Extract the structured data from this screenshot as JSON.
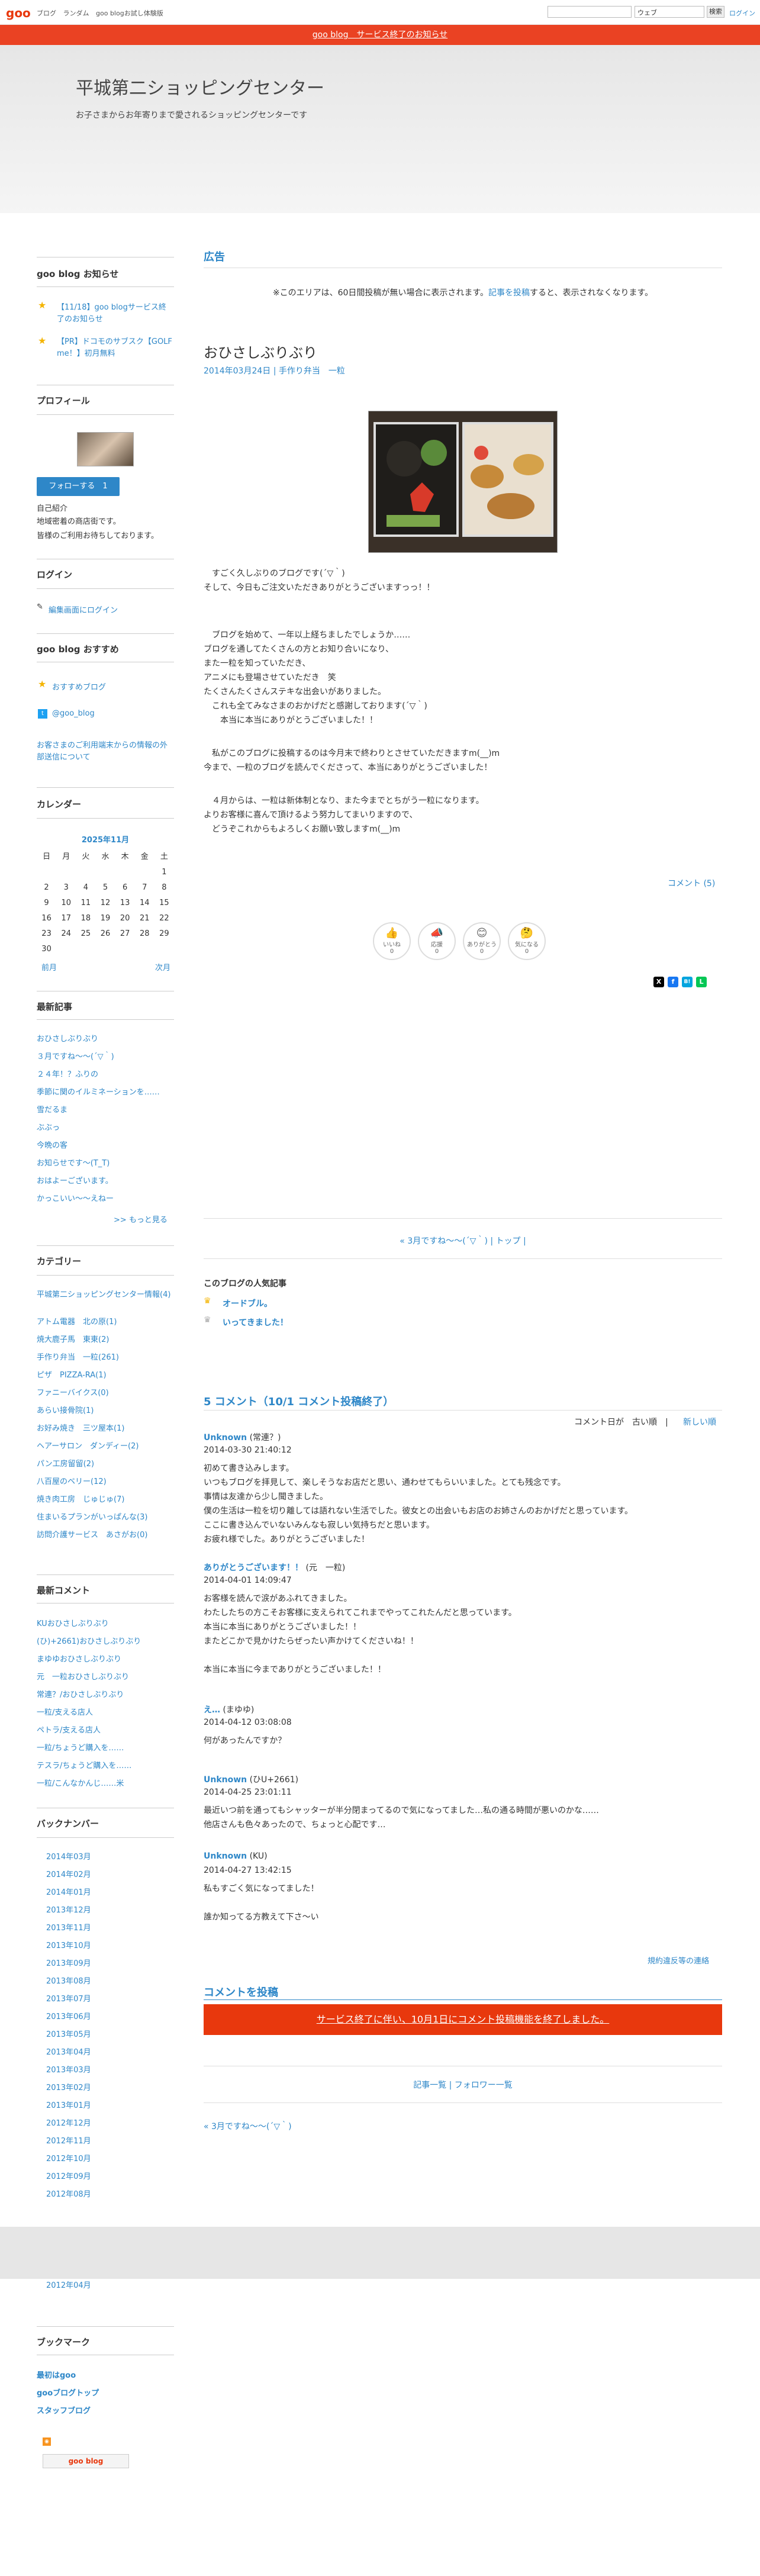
{
  "topbar": {
    "logo": "goo",
    "nav": [
      "ブログ",
      "ランダム",
      "goo blogお試し体験版"
    ],
    "search_select": "ウェブ",
    "search_button": "検索",
    "login": "ログイン"
  },
  "notice": "goo blog　サービス終了のお知らせ",
  "site": {
    "title": "平城第二ショッピングセンター",
    "description": "お子さまからお年寄りまで愛されるショッピングセンターです"
  },
  "sidebar": {
    "goo_notice_title": "goo blog お知らせ",
    "goo_notice_items": [
      "【11/18】goo blogサービス終了のお知らせ",
      "【PR】ドコモのサブスク【GOLF me！】初月無料"
    ],
    "profile_title": "プロフィール",
    "follow_button": "フォローする　1",
    "profile_label": "自己紹介",
    "profile_text": [
      "地域密着の商店街です。",
      "皆様のご利用お待ちしております。"
    ],
    "login_title": "ログイン",
    "login_link": "編集画面にログイン",
    "recommend_title": "goo blog おすすめ",
    "recommend_links": [
      "おすすめブログ",
      "@goo_blog"
    ],
    "recommend_note": "お客さまのご利用端末からの情報の外部送信について",
    "calendar_title": "カレンダー",
    "calendar_month": "2025年11月",
    "calendar_days": [
      "日",
      "月",
      "火",
      "水",
      "木",
      "金",
      "土"
    ],
    "calendar_weeks": [
      [
        "",
        "",
        "",
        "",
        "",
        "",
        "1"
      ],
      [
        "2",
        "3",
        "4",
        "5",
        "6",
        "7",
        "8"
      ],
      [
        "9",
        "10",
        "11",
        "12",
        "13",
        "14",
        "15"
      ],
      [
        "16",
        "17",
        "18",
        "19",
        "20",
        "21",
        "22"
      ],
      [
        "23",
        "24",
        "25",
        "26",
        "27",
        "28",
        "29"
      ],
      [
        "30",
        "",
        "",
        "",
        "",
        "",
        ""
      ]
    ],
    "calendar_prev": "前月",
    "calendar_next": "次月",
    "recent_title": "最新記事",
    "recent_items": [
      "おひさしぶりぶり",
      "３月ですね〜〜(´▽｀)",
      "２４年！？ふりの",
      "季節に関のイルミネーションを……",
      "雪だるま",
      "ぶぶっ",
      "今晩の客",
      "お知らせです〜(T_T)",
      "おはよーございます。",
      "かっこいい〜〜えねー"
    ],
    "recent_more": ">> もっと見る",
    "category_title": "カテゴリー",
    "categories": [
      "平城第二ショッピングセンター情報(4)",
      "アトム電器　北の原(1)",
      "焼大鹿子馬　東東(2)",
      "手作り弁当　一粒(261)",
      "ピザ　PIZZA-RA(1)",
      "ファニーバイクス(0)",
      "あらい接骨院(1)",
      "お好み焼き　三ツ屋本(1)",
      "ヘアーサロン　ダンディー(2)",
      "パン工房留留(2)",
      "八百屋のベリー(12)",
      "焼き肉工房　じゅじゅ(7)",
      "住まいるプランがいっぱんな(3)",
      "訪問介護サービス　あさがお(0)"
    ],
    "comments_title": "最新コメント",
    "comments": [
      "KUおひさしぶりぶり",
      "(ひ)+2661)おひさしぶりぶり",
      "まゆゆおひさしぶりぶり",
      "元　一粒おひさしぶりぶり",
      "常連？/おひさしぶりぶり",
      "一粒/支える店人",
      "ペトラ/支える店人",
      "一粒/ちょうど購入を……",
      "テスラ/ちょうど購入を……",
      "一粒/こんなかんじ……米"
    ],
    "backnumber_title": "バックナンバー",
    "backnumbers": [
      "2014年03月",
      "2014年02月",
      "2014年01月",
      "2013年12月",
      "2013年11月",
      "2013年10月",
      "2013年09月",
      "2013年08月",
      "2013年07月",
      "2013年06月",
      "2013年05月",
      "2013年04月",
      "2013年03月",
      "2013年02月",
      "2013年01月",
      "2012年12月",
      "2012年11月",
      "2012年10月",
      "2012年09月",
      "2012年08月",
      "2012年04月"
    ],
    "bookmark_title": "ブックマーク",
    "bookmarks": [
      "最初はgoo",
      "gooブログトップ",
      "スタッフブログ"
    ],
    "badge": "goo blog"
  },
  "main": {
    "ad_heading": "広告",
    "ad_note_pre": "※このエリアは、60日間投稿が無い場合に表示されます。",
    "ad_note_link": "記事を投稿",
    "ad_note_post": "すると、表示されなくなります。",
    "entry_title": "おひさしぶりぶり",
    "entry_date": "2014年03月24日 | 手作り弁当　一粒",
    "body": [
      "　すごく久しぶりのブログです(´▽｀)",
      "そして、今日もご注文いただきありがとうございますっっ！！",
      "",
      "",
      "　ブログを始めて、一年以上経ちましたでしょうか……",
      "ブログを通してたくさんの方とお知り合いになり、",
      "また一粒を知っていただき、",
      "アニメにも登場させていただき　笑",
      "たくさんたくさんステキな出会いがありました。",
      "　これも全てみなさまのおかげだと感謝しております(´▽｀)",
      "　　本当に本当にありがとうございました！！",
      "",
      "　私がこのブログに投稿するのは今月末で終わりとさせていただきますm(__)m",
      "今まで、一粒のブログを読んでくださって、本当にありがとうございました！",
      "",
      "　４月からは、一粒は新体制となり、また今までとちがう一粒になります。",
      "よりお客様に喜んで頂けるよう努力してまいりますので、",
      "　どうぞこれからもよろしくお願い致しますm(__)m"
    ],
    "comment_link": "コメント (5)",
    "reactions": [
      "いいね",
      "応援",
      "ありがとう",
      "気になる"
    ],
    "reaction_counts": [
      "0",
      "0",
      "0",
      "0"
    ],
    "share": [
      "X",
      "f",
      "B!",
      "L"
    ],
    "pager": "« 3月ですね〜〜(´▽｀) | トップ |",
    "popular_title": "このブログの人気記事",
    "popular": [
      "オードブル。",
      "いってきました！"
    ],
    "comments_heading": "5 コメント（10/1 コメント投稿終了）",
    "comments_sort": "コメント日が　古い順　|",
    "comments_sort_new": "新しい順",
    "comments": [
      {
        "name": "Unknown",
        "suffix": " (常連？)",
        "date": "2014-03-30 21:40:12",
        "lines": [
          "初めて書き込みします。",
          "いつもブログを拝見して、楽しそうなお店だと思い、通わせてもらいいました。とても残念です。",
          "事情は友達から少し聞きました。",
          "僕の生活は一粒を切り離しては語れない生活でした。彼女との出会いもお店のお姉さんのおかげだと思っています。",
          "ここに書き込んでいないみんなも寂しい気持ちだと思います。",
          "お疲れ様でした。ありがとうございました！"
        ]
      },
      {
        "name": "ありがとうございます！！",
        "suffix": " (元　一粒)",
        "date": "2014-04-01 14:09:47",
        "lines": [
          "お客様を読んで涙があふれてきました。",
          "わたしたちの方こそお客様に支えられてこれまでやってこれたんだと思っています。",
          "本当に本当にありがとうございました！！",
          "またどこかで見かけたらぜったい声かけてくださいね！！",
          "",
          "本当に本当に今までありがとうございました！！"
        ]
      },
      {
        "name": "え…",
        "suffix": " (まゆゆ)",
        "date": "2014-04-12 03:08:08",
        "lines": [
          "何があったんですか？"
        ]
      },
      {
        "name": "Unknown",
        "suffix": " (ひU+2661)",
        "date": "2014-04-25 23:01:11",
        "lines": [
          "最近いつ前を通ってもシャッターが半分閉まってるので気になってました…私の通る時間が悪いのかな……",
          "他店さんも色々あったので、ちょっと心配です…"
        ]
      },
      {
        "name": "Unknown",
        "suffix": " (KU)",
        "date": "2014-04-27 13:42:15",
        "lines": [
          "私もすごく気になってました！",
          "",
          "誰か知ってる方教えて下さ〜い"
        ]
      }
    ],
    "report_link": "規約違反等の連絡",
    "post_heading": "コメントを投稿",
    "post_button": "サービス終了に伴い、10月1日にコメント投稿機能を終了しました。",
    "footer_links": "記事一覧 | フォロワー一覧",
    "footer_prev": "« 3月ですね〜〜(´▽｀)"
  }
}
